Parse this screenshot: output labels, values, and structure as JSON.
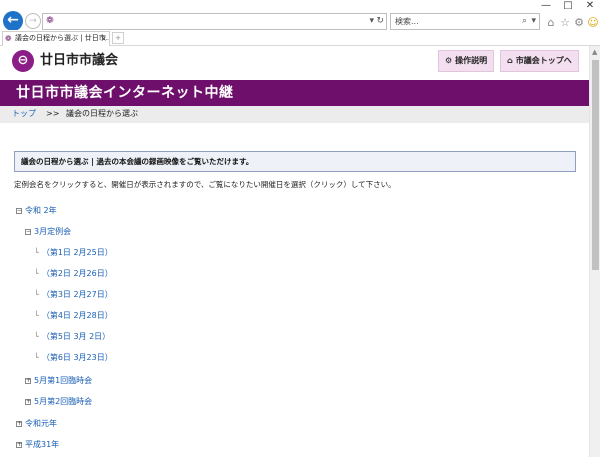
{
  "browser": {
    "back_glyph": "←",
    "forward_glyph": "→",
    "address_icons": {
      "dropdown": "▾",
      "refresh": "↻"
    },
    "search_placeholder": "検索...",
    "search_icons": {
      "search": "⌕",
      "dropdown": "▾"
    },
    "toolbar_icons": {
      "home": "⌂",
      "favorites": "☆",
      "settings": "⚙",
      "smiley": "☺"
    },
    "window_controls": {
      "minimize": "—",
      "maximize": "□",
      "close": "✕"
    },
    "tab": {
      "title": "議会の日程から選ぶ | 廿日市...",
      "close": "×"
    },
    "newtab_glyph": "+"
  },
  "header": {
    "logo_glyph": "⊖",
    "site_name": "廿日市市議会",
    "buttons": [
      {
        "label": "操作説明",
        "icon": "⚙"
      },
      {
        "label": "市議会トップへ",
        "icon": "⌂"
      }
    ]
  },
  "banner": {
    "title": "廿日市市議会インターネット中継"
  },
  "breadcrumb": {
    "home": "トップ",
    "separator": ">>",
    "current": "議会の日程から選ぶ"
  },
  "notice": {
    "text": "議会の日程から選ぶ | 過去の本会議の録画映像をご覧いただけます。"
  },
  "instructions": "定例会名をクリックすると、開催日が表示されますので、ご覧になりたい開催日を選択（クリック）して下さい。",
  "tree": {
    "toggle_open": "−",
    "toggle_closed": "+",
    "branch_glyph": "└",
    "year_2": "令和 2年",
    "session_march": "3月定例会",
    "days": [
      "（第1日 2月25日）",
      "（第2日 2月26日）",
      "（第3日 2月27日）",
      "（第4日 2月28日）",
      "（第5日 3月 2日）",
      "（第6日 3月23日）"
    ],
    "session_may1": "5月第1回臨時会",
    "session_may2": "5月第2回臨時会",
    "year_1": "令和元年",
    "year_h31": "平成31年"
  }
}
